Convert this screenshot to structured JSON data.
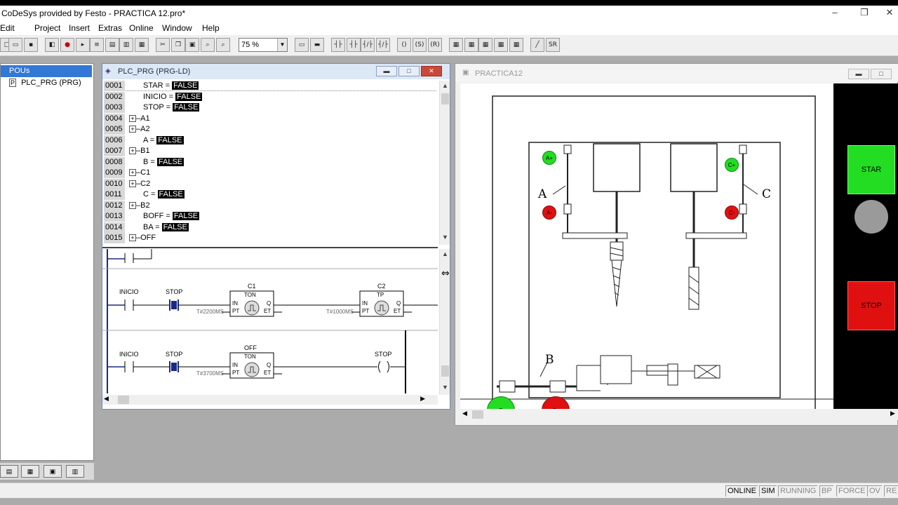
{
  "window": {
    "title": "CoDeSys provided by Festo - PRACTICA 12.pro*",
    "minimize": "–",
    "restore": "❐",
    "close": "✕"
  },
  "menu": [
    "Edit",
    "Project",
    "Insert",
    "Extras",
    "Online",
    "Window",
    "Help"
  ],
  "toolbar": {
    "zoom": "75 %"
  },
  "pou_panel": {
    "root_label": "POUs",
    "items": [
      "PLC_PRG (PRG)"
    ]
  },
  "prg_window": {
    "title": "PLC_PRG (PRG-LD)",
    "declarations": [
      {
        "num": "0001",
        "name": "STAR",
        "value": "FALSE",
        "tree": false
      },
      {
        "num": "0002",
        "name": "INICIO",
        "value": "FALSE",
        "tree": false
      },
      {
        "num": "0003",
        "name": "STOP",
        "value": "FALSE",
        "tree": false
      },
      {
        "num": "0004",
        "name": "A1",
        "value": null,
        "tree": true
      },
      {
        "num": "0005",
        "name": "A2",
        "value": null,
        "tree": true
      },
      {
        "num": "0006",
        "name": "A",
        "value": "FALSE",
        "tree": false
      },
      {
        "num": "0007",
        "name": "B1",
        "value": null,
        "tree": true
      },
      {
        "num": "0008",
        "name": "B",
        "value": "FALSE",
        "tree": false
      },
      {
        "num": "0009",
        "name": "C1",
        "value": null,
        "tree": true
      },
      {
        "num": "0010",
        "name": "C2",
        "value": null,
        "tree": true
      },
      {
        "num": "0011",
        "name": "C",
        "value": "FALSE",
        "tree": false
      },
      {
        "num": "0012",
        "name": "B2",
        "value": null,
        "tree": true
      },
      {
        "num": "0013",
        "name": "BOFF",
        "value": "FALSE",
        "tree": false
      },
      {
        "num": "0014",
        "name": "BA",
        "value": "FALSE",
        "tree": false
      },
      {
        "num": "0015",
        "name": "OFF",
        "value": null,
        "tree": true
      }
    ],
    "ladder": {
      "rung1": {
        "contact1": "INICIO",
        "contact2": "STOP",
        "block1": {
          "instance": "C1",
          "type": "TON",
          "in": "IN",
          "pt": "PT",
          "q": "Q",
          "et": "ET",
          "preset": "T#2200MS"
        },
        "block2": {
          "instance": "C2",
          "type": "TP",
          "in": "IN",
          "pt": "PT",
          "q": "Q",
          "et": "ET",
          "preset": "T#1000MS"
        }
      },
      "rung2": {
        "contact1": "INICIO",
        "contact2": "STOP",
        "block1": {
          "instance": "OFF",
          "type": "TON",
          "in": "IN",
          "pt": "PT",
          "q": "Q",
          "et": "ET",
          "preset": "T#3700MS"
        },
        "coil": "STOP",
        "coil_symbol": "( )"
      }
    }
  },
  "vis_window": {
    "title": "PRACTICA12",
    "diagram_labels": {
      "a": "A",
      "b": "B",
      "c": "C"
    },
    "lamps": {
      "a_top": "A+",
      "a_bottom": "A-",
      "c_top": "C+",
      "c_bottom": "C-",
      "b_left": "B",
      "b_right": "B-"
    },
    "star_button": "STAR",
    "stop_button": "STOP",
    "colors": {
      "green": "#22dd22",
      "red": "#e01010",
      "gray": "#9a9a9a"
    }
  },
  "statusbar": [
    "ONLINE",
    "SIM",
    "RUNNING",
    "BP",
    "FORCE",
    "OV",
    "RE"
  ]
}
